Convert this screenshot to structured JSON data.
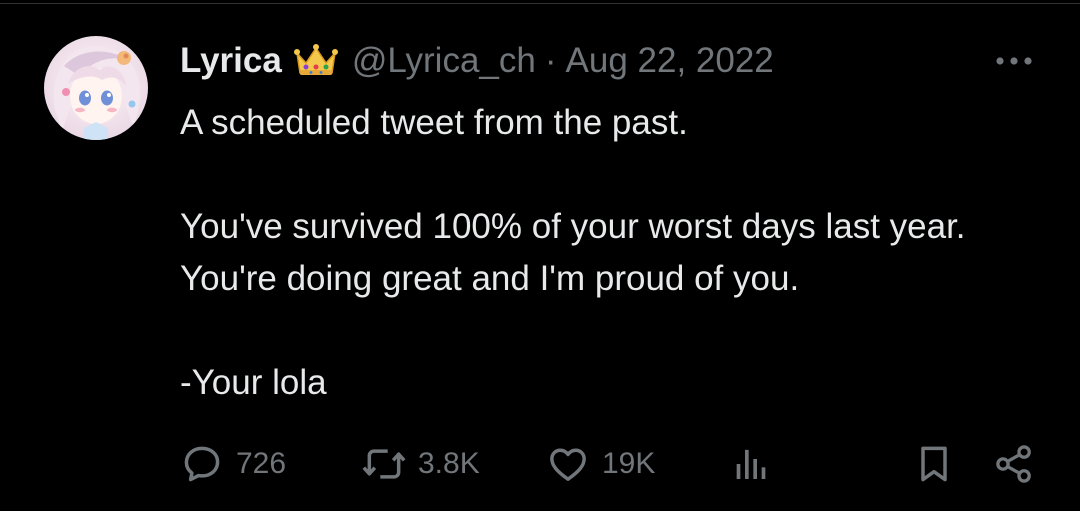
{
  "tweet": {
    "author": {
      "display_name": "Lyrica",
      "badge_icon": "crown-emoji-icon",
      "handle": "@Lyrica_ch"
    },
    "separator": "·",
    "date": "Aug 22, 2022",
    "more_icon": "more-options-icon",
    "text": {
      "line1": "A scheduled tweet from the past.",
      "line2": "You've survived 100% of your worst days last year. You're doing great and I'm proud of you.",
      "line3": "-Your lola"
    },
    "actions": {
      "replies": "726",
      "retweets": "3.8K",
      "likes": "19K"
    }
  },
  "colors": {
    "background": "#000000",
    "text_primary": "#e7e9ea",
    "text_secondary": "#71767b",
    "divider": "#2f3336"
  }
}
